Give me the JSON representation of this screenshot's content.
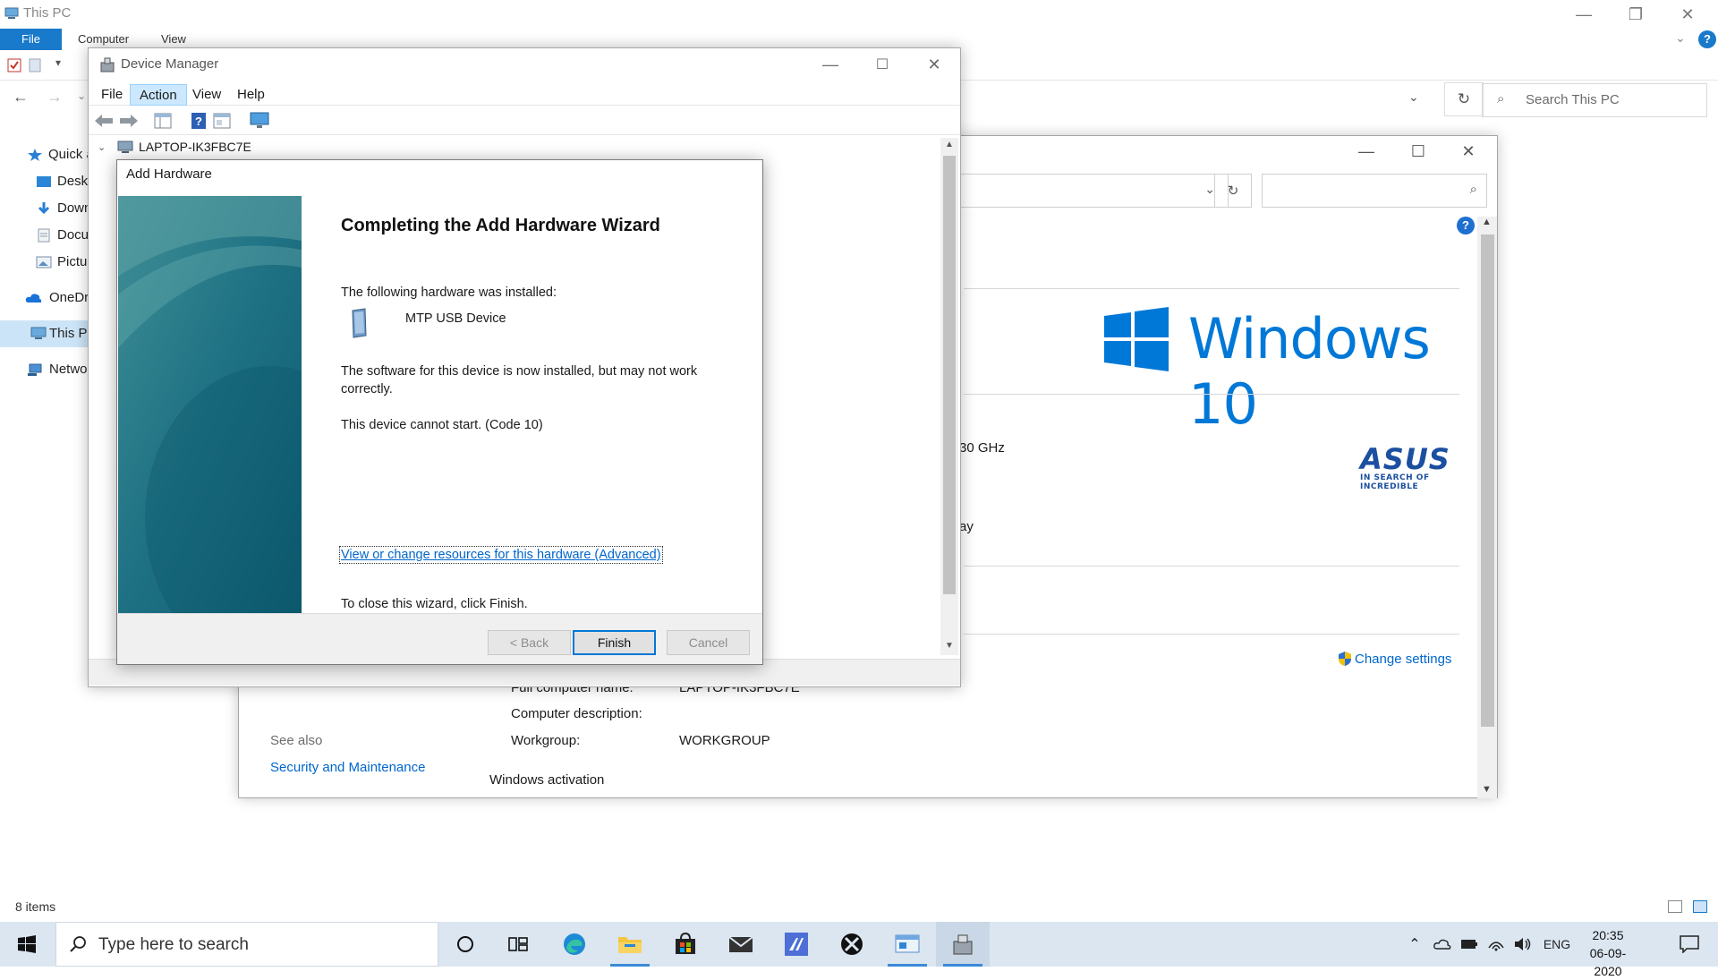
{
  "explorer": {
    "title": "This PC",
    "ribbon_tabs": [
      "File",
      "Computer",
      "View"
    ],
    "search_placeholder": "Search This PC",
    "sidebar": [
      {
        "label": "Quick access",
        "icon": "star-icon"
      },
      {
        "label": "Desktop",
        "icon": "desktop-icon"
      },
      {
        "label": "Downloads",
        "icon": "download-icon"
      },
      {
        "label": "Documents",
        "icon": "documents-icon"
      },
      {
        "label": "Pictures",
        "icon": "pictures-icon"
      },
      {
        "label": "OneDrive",
        "icon": "cloud-icon"
      },
      {
        "label": "This PC",
        "icon": "computer-icon",
        "selected": true
      },
      {
        "label": "Network",
        "icon": "network-icon"
      }
    ],
    "status": "8 items"
  },
  "system_window": {
    "windows_logo_text": "Windows 10",
    "processor_fragment": "30 GHz",
    "display_fragment": "ay",
    "change_settings": "Change settings",
    "full_computer_name_label": "Full computer name:",
    "full_computer_name_value": "LAPTOP-IK3FBC7E",
    "computer_description_label": "Computer description:",
    "workgroup_label": "Workgroup:",
    "workgroup_value": "WORKGROUP",
    "see_also": "See also",
    "security_link": "Security and Maintenance",
    "windows_activation": "Windows activation",
    "asus_brand": "ASUS",
    "asus_tagline": "IN SEARCH OF INCREDIBLE"
  },
  "device_manager": {
    "title": "Device Manager",
    "menu": [
      "File",
      "Action",
      "View",
      "Help"
    ],
    "active_menu": "Action",
    "tree_root": "LAPTOP-IK3FBC7E"
  },
  "wizard": {
    "title": "Add Hardware",
    "heading": "Completing the Add Hardware Wizard",
    "installed_label": "The following hardware was installed:",
    "device_name": "MTP USB Device",
    "software_note": "The software for this device is now installed, but may not work correctly.",
    "error": "This device cannot start. (Code 10)",
    "advanced_link": "View or change resources for this hardware (Advanced)",
    "close_hint": "To close this wizard, click Finish.",
    "buttons": {
      "back": "< Back",
      "finish": "Finish",
      "cancel": "Cancel"
    }
  },
  "taskbar": {
    "search_placeholder": "Type here to search",
    "language": "ENG",
    "time": "20:35",
    "date": "06-09-2020"
  },
  "colors": {
    "accent": "#0078d7",
    "file_tab": "#1979ca",
    "taskbar": "#dbe6f1",
    "wizard_banner": "#1f6f7e"
  }
}
